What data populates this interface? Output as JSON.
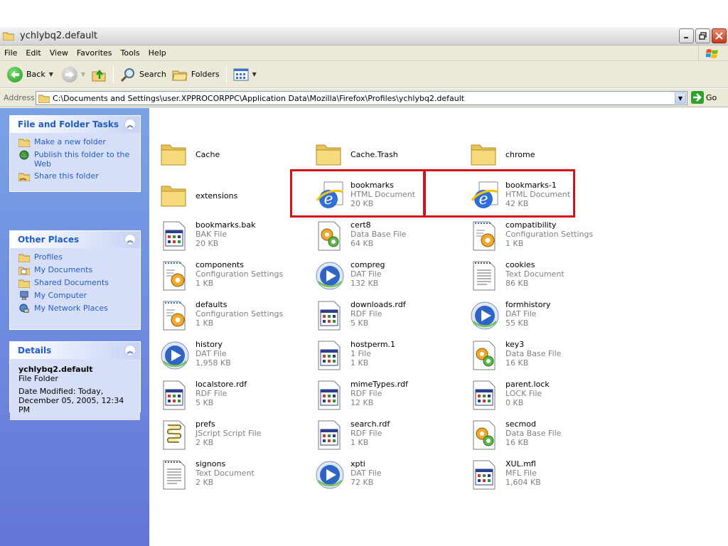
{
  "window": {
    "title": "ychlybq2.default"
  },
  "menu": [
    "File",
    "Edit",
    "View",
    "Favorites",
    "Tools",
    "Help"
  ],
  "toolbar": {
    "back_label": "Back",
    "search_label": "Search",
    "folders_label": "Folders"
  },
  "address": {
    "label": "Address",
    "path": "C:\\Documents and Settings\\user.XPPROCORPPC\\Application Data\\Mozilla\\Firefox\\Profiles\\ychlybq2.default",
    "go_label": "Go"
  },
  "tasks_panel": {
    "title": "File and Folder Tasks",
    "items": [
      "Make a new folder",
      "Publish this folder to the Web",
      "Share this folder"
    ]
  },
  "places_panel": {
    "title": "Other Places",
    "items": [
      "Profiles",
      "My Documents",
      "Shared Documents",
      "My Computer",
      "My Network Places"
    ]
  },
  "details_panel": {
    "title": "Details",
    "name": "ychlybq2.default",
    "type": "File Folder",
    "modified_1": "Date Modified: Today,",
    "modified_2": "December 05, 2005, 12:34 PM"
  },
  "files": [
    {
      "name": "Cache",
      "type": "",
      "size": "",
      "icon": "folder-icon"
    },
    {
      "name": "Cache.Trash",
      "type": "",
      "size": "",
      "icon": "folder-icon"
    },
    {
      "name": "chrome",
      "type": "",
      "size": "",
      "icon": "folder-icon"
    },
    {
      "name": "extensions",
      "type": "",
      "size": "",
      "icon": "folder-icon"
    },
    {
      "name": "bookmarks",
      "type": "HTML Document",
      "size": "20 KB",
      "icon": "ie-html-icon"
    },
    {
      "name": "bookmarks-1",
      "type": "HTML Document",
      "size": "42 KB",
      "icon": "ie-html-icon"
    },
    {
      "name": "bookmarks.bak",
      "type": "BAK File",
      "size": "20 KB",
      "icon": "generic-file-icon"
    },
    {
      "name": "cert8",
      "type": "Data Base File",
      "size": "64 KB",
      "icon": "database-file-icon"
    },
    {
      "name": "compatibility",
      "type": "Configuration Settings",
      "size": "1 KB",
      "icon": "config-file-icon"
    },
    {
      "name": "components",
      "type": "Configuration Settings",
      "size": "1 KB",
      "icon": "config-file-icon"
    },
    {
      "name": "compreg",
      "type": "DAT File",
      "size": "132 KB",
      "icon": "media-player-icon"
    },
    {
      "name": "cookies",
      "type": "Text Document",
      "size": "86 KB",
      "icon": "text-file-icon"
    },
    {
      "name": "defaults",
      "type": "Configuration Settings",
      "size": "1 KB",
      "icon": "config-file-icon"
    },
    {
      "name": "downloads.rdf",
      "type": "RDF File",
      "size": "5 KB",
      "icon": "generic-file-icon"
    },
    {
      "name": "formhistory",
      "type": "DAT File",
      "size": "55 KB",
      "icon": "media-player-icon"
    },
    {
      "name": "history",
      "type": "DAT File",
      "size": "1,958 KB",
      "icon": "media-player-icon"
    },
    {
      "name": "hostperm.1",
      "type": "1 File",
      "size": "1 KB",
      "icon": "generic-file-icon"
    },
    {
      "name": "key3",
      "type": "Data Base File",
      "size": "16 KB",
      "icon": "database-file-icon"
    },
    {
      "name": "localstore.rdf",
      "type": "RDF File",
      "size": "5 KB",
      "icon": "generic-file-icon"
    },
    {
      "name": "mimeTypes.rdf",
      "type": "RDF File",
      "size": "12 KB",
      "icon": "generic-file-icon"
    },
    {
      "name": "parent.lock",
      "type": "LOCK File",
      "size": "0 KB",
      "icon": "generic-file-icon"
    },
    {
      "name": "prefs",
      "type": "JScript Script File",
      "size": "2 KB",
      "icon": "script-file-icon"
    },
    {
      "name": "search.rdf",
      "type": "RDF File",
      "size": "1 KB",
      "icon": "generic-file-icon"
    },
    {
      "name": "secmod",
      "type": "Data Base File",
      "size": "16 KB",
      "icon": "database-file-icon"
    },
    {
      "name": "signons",
      "type": "Text Document",
      "size": "2 KB",
      "icon": "text-file-icon"
    },
    {
      "name": "xpti",
      "type": "DAT File",
      "size": "72 KB",
      "icon": "media-player-icon"
    },
    {
      "name": "XUL.mfl",
      "type": "MFL File",
      "size": "1,604 KB",
      "icon": "generic-file-icon"
    }
  ],
  "colors": {
    "highlight": "#d61015",
    "sidebar_top": "#7ba2e7",
    "sidebar_bottom": "#6375d6",
    "task_link": "#215dc6"
  }
}
